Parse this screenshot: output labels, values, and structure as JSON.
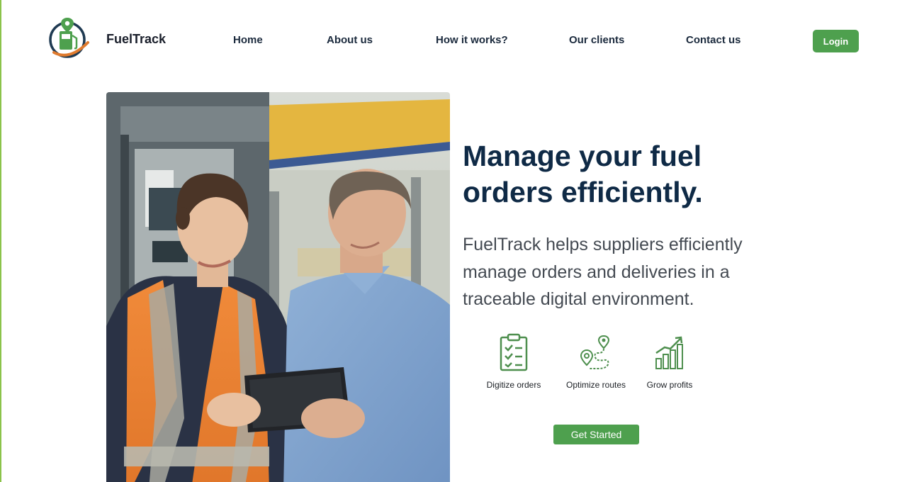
{
  "header": {
    "brand": "FuelTrack",
    "logo_icon": "fuel-pump-location-icon",
    "nav": [
      {
        "label": "Home"
      },
      {
        "label": "About us"
      },
      {
        "label": "How it works?"
      },
      {
        "label": "Our clients"
      },
      {
        "label": "Contact us"
      }
    ],
    "login_label": "Login"
  },
  "hero": {
    "photo_alt": "Fuel station attendant and supplier looking at a tablet",
    "headline": "Manage your fuel orders efficiently.",
    "subtext": "FuelTrack helps suppliers efficiently manage orders and deliveries in a traceable digital environment.",
    "features": [
      {
        "label": "Digitize orders",
        "icon": "clipboard-checklist-icon"
      },
      {
        "label": "Optimize routes",
        "icon": "route-pins-icon"
      },
      {
        "label": "Grow profits",
        "icon": "growth-chart-icon"
      }
    ],
    "cta_label": "Get Started"
  },
  "colors": {
    "accent_green": "#4ea04e",
    "headline_navy": "#0f2a46",
    "logo_orange": "#e07b2e"
  }
}
